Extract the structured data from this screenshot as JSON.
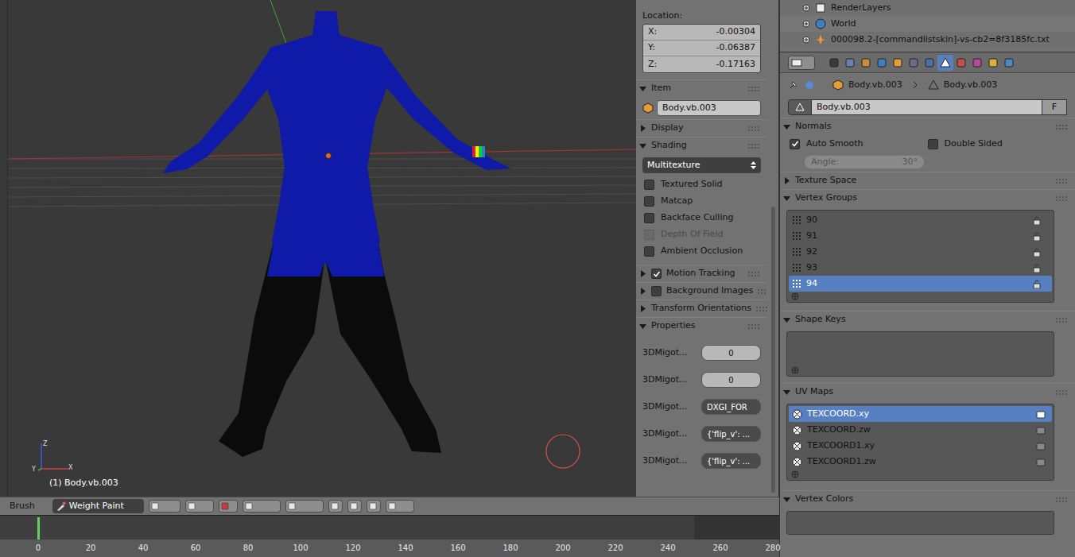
{
  "viewport": {
    "object_label": "(1) Body.vb.003",
    "axes": [
      "Z",
      "Y",
      "X"
    ]
  },
  "n_panel": {
    "location": {
      "label": "Location:",
      "fields": [
        {
          "axis": "X:",
          "value": "-0.00304"
        },
        {
          "axis": "Y:",
          "value": "-0.06387"
        },
        {
          "axis": "Z:",
          "value": "-0.17163"
        }
      ]
    },
    "item": {
      "title": "Item",
      "expanded": true,
      "name": "Body.vb.003"
    },
    "display": {
      "title": "Display",
      "expanded": false
    },
    "shading": {
      "title": "Shading",
      "expanded": true,
      "mode": "Multitexture",
      "options": [
        {
          "label": "Textured Solid",
          "checked": false,
          "disabled": false
        },
        {
          "label": "Matcap",
          "checked": false,
          "disabled": false
        },
        {
          "label": "Backface Culling",
          "checked": false,
          "disabled": false
        },
        {
          "label": "Depth Of Field",
          "checked": false,
          "disabled": true
        },
        {
          "label": "Ambient Occlusion",
          "checked": false,
          "disabled": false
        }
      ]
    },
    "sections": [
      {
        "title": "Motion Tracking",
        "expanded": false,
        "kind": "toggle",
        "checked": true
      },
      {
        "title": "Background Images",
        "expanded": false,
        "kind": "toggle",
        "checked": false
      },
      {
        "title": "Transform Orientations",
        "expanded": false,
        "kind": "plain"
      }
    ],
    "properties": {
      "title": "Properties",
      "expanded": true,
      "rows": [
        {
          "label": "3DMigot...",
          "value": "0",
          "kind": "number"
        },
        {
          "label": "3DMigot...",
          "value": "0",
          "kind": "number"
        },
        {
          "label": "3DMigot...",
          "value": "DXGI_FOR",
          "kind": "text"
        },
        {
          "label": "3DMigot...",
          "value": "{'flip_v': ...",
          "kind": "text"
        },
        {
          "label": "3DMigot...",
          "value": "{'flip_v': ...",
          "kind": "text"
        }
      ]
    }
  },
  "header": {
    "brush_label": "Brush",
    "mode": "Weight Paint"
  },
  "timeline": {
    "ticks": [
      "0",
      "20",
      "40",
      "60",
      "80",
      "100",
      "120",
      "140",
      "160",
      "180",
      "200",
      "220",
      "240",
      "260",
      "280"
    ],
    "current_frame": 0,
    "frame_end": 250
  },
  "outliner": {
    "rows": [
      {
        "label": "RenderLayers",
        "kind": "renderlayers"
      },
      {
        "label": "World",
        "kind": "world"
      },
      {
        "label": "000098.2-[commandlistskin]-vs-cb2=8f3185fc.txt",
        "kind": "object"
      }
    ]
  },
  "properties_editor": {
    "tabs": [
      {
        "kind": "render",
        "selected": false
      },
      {
        "kind": "layers",
        "selected": false
      },
      {
        "kind": "scene",
        "selected": false
      },
      {
        "kind": "world",
        "selected": false
      },
      {
        "kind": "object",
        "selected": false
      },
      {
        "kind": "constraints",
        "selected": false
      },
      {
        "kind": "modifiers",
        "selected": false
      },
      {
        "kind": "data",
        "selected": true
      },
      {
        "kind": "material",
        "selected": false
      },
      {
        "kind": "texture",
        "selected": false
      },
      {
        "kind": "particles",
        "selected": false
      },
      {
        "kind": "physics",
        "selected": false
      }
    ],
    "breadcrumb": [
      "Body.vb.003",
      "Body.vb.003"
    ],
    "datablock": {
      "name": "Body.vb.003",
      "fake_user": "F"
    },
    "normals": {
      "title": "Normals",
      "expanded": true,
      "options": [
        {
          "label": "Auto Smooth",
          "checked": true
        },
        {
          "label": "Double Sided",
          "checked": false
        }
      ],
      "angle": {
        "label": "Angle:",
        "value": "30°",
        "disabled": true
      }
    },
    "texture_space": {
      "title": "Texture Space",
      "expanded": false
    },
    "vertex_groups": {
      "title": "Vertex Groups",
      "expanded": true,
      "items": [
        {
          "name": "90",
          "selected": false
        },
        {
          "name": "91",
          "selected": false
        },
        {
          "name": "92",
          "selected": false
        },
        {
          "name": "93",
          "selected": false
        },
        {
          "name": "94",
          "selected": true
        }
      ]
    },
    "shape_keys": {
      "title": "Shape Keys",
      "expanded": true,
      "items": []
    },
    "uv_maps": {
      "title": "UV Maps",
      "expanded": true,
      "items": [
        {
          "name": "TEXCOORD.xy",
          "selected": true,
          "active_render": true
        },
        {
          "name": "TEXCOORD.zw",
          "selected": false,
          "active_render": false
        },
        {
          "name": "TEXCOORD1.xy",
          "selected": false,
          "active_render": false
        },
        {
          "name": "TEXCOORD1.zw",
          "selected": false,
          "active_render": false
        }
      ]
    },
    "vertex_colors": {
      "title": "Vertex Colors",
      "expanded": true
    }
  }
}
